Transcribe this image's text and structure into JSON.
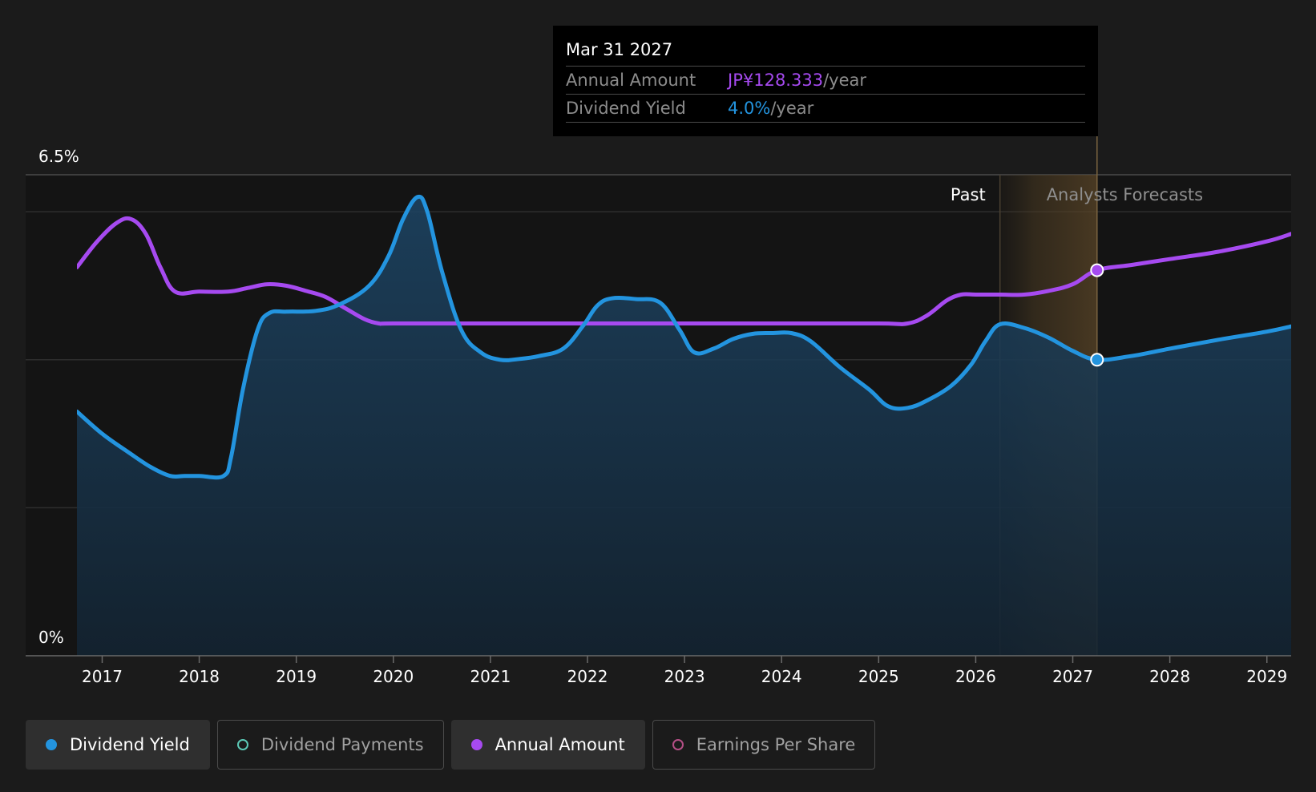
{
  "chart_data": {
    "type": "line",
    "y_labels": {
      "top": "6.5%",
      "bottom": "0%"
    },
    "ylim": [
      0,
      6.5
    ],
    "xlim": [
      2016.74,
      2029.25
    ],
    "x_ticks": [
      "2017",
      "2018",
      "2019",
      "2020",
      "2021",
      "2022",
      "2023",
      "2024",
      "2025",
      "2026",
      "2027",
      "2028",
      "2029"
    ],
    "past_label": "Past",
    "forecast_label": "Analysts Forecasts",
    "forecast_start": 2026.25,
    "hover_x": 2027.25,
    "grid": true,
    "colors": {
      "dividend_yield": "#2394df",
      "annual_amount": "#a64af0",
      "dividend_payments": "#5cc9b6",
      "earnings_per_share": "#b54f86"
    },
    "series": [
      {
        "name": "Dividend Yield",
        "unit": "%",
        "color": "#2394df",
        "x": [
          2016.74,
          2017.0,
          2017.27,
          2017.5,
          2017.7,
          2017.85,
          2018.0,
          2018.25,
          2018.33,
          2018.45,
          2018.6,
          2018.72,
          2018.9,
          2019.2,
          2019.45,
          2019.75,
          2019.95,
          2020.1,
          2020.25,
          2020.35,
          2020.5,
          2020.7,
          2020.9,
          2021.1,
          2021.3,
          2021.5,
          2021.75,
          2021.95,
          2022.1,
          2022.25,
          2022.5,
          2022.75,
          2022.95,
          2023.1,
          2023.3,
          2023.5,
          2023.7,
          2023.9,
          2024.1,
          2024.3,
          2024.6,
          2024.9,
          2025.1,
          2025.3,
          2025.5,
          2025.75,
          2025.95,
          2026.1,
          2026.25,
          2026.5,
          2026.75,
          2027.0,
          2027.25,
          2027.6,
          2028.0,
          2028.5,
          2029.0,
          2029.25
        ],
        "values": [
          3.3,
          3.0,
          2.75,
          2.55,
          2.43,
          2.43,
          2.43,
          2.43,
          2.7,
          3.6,
          4.4,
          4.63,
          4.65,
          4.66,
          4.75,
          5.0,
          5.4,
          5.9,
          6.2,
          6.0,
          5.2,
          4.4,
          4.1,
          4.0,
          4.01,
          4.05,
          4.15,
          4.45,
          4.73,
          4.83,
          4.82,
          4.77,
          4.4,
          4.1,
          4.15,
          4.28,
          4.35,
          4.36,
          4.36,
          4.25,
          3.9,
          3.6,
          3.37,
          3.35,
          3.45,
          3.65,
          3.93,
          4.25,
          4.48,
          4.43,
          4.3,
          4.12,
          4.0,
          4.05,
          4.15,
          4.27,
          4.38,
          4.45
        ]
      },
      {
        "name": "Annual Amount",
        "unit": "JP¥",
        "color": "#a64af0",
        "x": [
          2016.74,
          2016.95,
          2017.15,
          2017.3,
          2017.45,
          2017.6,
          2017.75,
          2018.0,
          2018.3,
          2018.5,
          2018.7,
          2018.9,
          2019.1,
          2019.3,
          2019.5,
          2019.7,
          2019.85,
          2020.0,
          2021.0,
          2022.0,
          2023.0,
          2024.0,
          2025.0,
          2025.3,
          2025.5,
          2025.7,
          2025.85,
          2026.0,
          2026.25,
          2026.5,
          2026.75,
          2027.0,
          2027.25,
          2027.6,
          2028.0,
          2028.5,
          2029.0,
          2029.25
        ],
        "values": [
          5.25,
          5.6,
          5.85,
          5.9,
          5.7,
          5.25,
          4.92,
          4.92,
          4.92,
          4.97,
          5.02,
          5.0,
          4.93,
          4.85,
          4.7,
          4.55,
          4.49,
          4.49,
          4.49,
          4.49,
          4.49,
          4.49,
          4.49,
          4.49,
          4.6,
          4.8,
          4.88,
          4.88,
          4.88,
          4.88,
          4.93,
          5.02,
          5.21,
          5.28,
          5.36,
          5.46,
          5.6,
          5.7
        ]
      }
    ]
  },
  "tooltip": {
    "date": "Mar 31 2027",
    "annual_amount_label": "Annual Amount",
    "annual_amount_value": "JP¥128.333",
    "annual_amount_unit": "/year",
    "dividend_yield_label": "Dividend Yield",
    "dividend_yield_value": "4.0%",
    "dividend_yield_unit": "/year"
  },
  "legend": {
    "items": [
      {
        "label": "Dividend Yield",
        "active": true,
        "color": "#2394df"
      },
      {
        "label": "Dividend Payments",
        "active": false,
        "color": "#5cc9b6"
      },
      {
        "label": "Annual Amount",
        "active": true,
        "color": "#a64af0"
      },
      {
        "label": "Earnings Per Share",
        "active": false,
        "color": "#b54f86"
      }
    ]
  }
}
